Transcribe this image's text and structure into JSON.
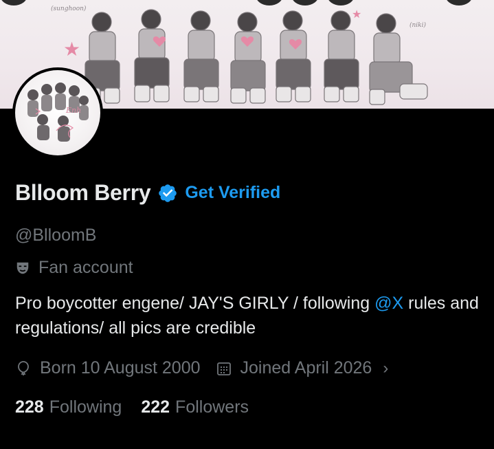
{
  "banner": {
    "captions": [
      "(sunghoon)",
      "(niki)"
    ],
    "accent_color": "#e58aa6"
  },
  "profile": {
    "display_name": "Blloom Berry",
    "verified_icon": "verified-badge-icon",
    "get_verified_label": "Get Verified",
    "handle": "@BlloomB",
    "category_icon": "theater-mask-icon",
    "category": "Fan account",
    "bio": {
      "text_before": "Pro boycotter engene/ JAY'S GIRLY / following ",
      "mention": "@X",
      "text_after": " rules and regulations/ all pics are credible"
    },
    "birth_icon": "balloon-icon",
    "birth": "Born 10 August 2000",
    "joined_icon": "calendar-icon",
    "joined": "Joined April 2026",
    "more_icon": "chevron-right-icon",
    "more_symbol": "›",
    "following_count": "228",
    "following_label": "Following",
    "followers_count": "222",
    "followers_label": "Followers"
  },
  "colors": {
    "background": "#000000",
    "primary_text": "#e7e9ea",
    "secondary_text": "#71767b",
    "link": "#1d9bf0"
  }
}
